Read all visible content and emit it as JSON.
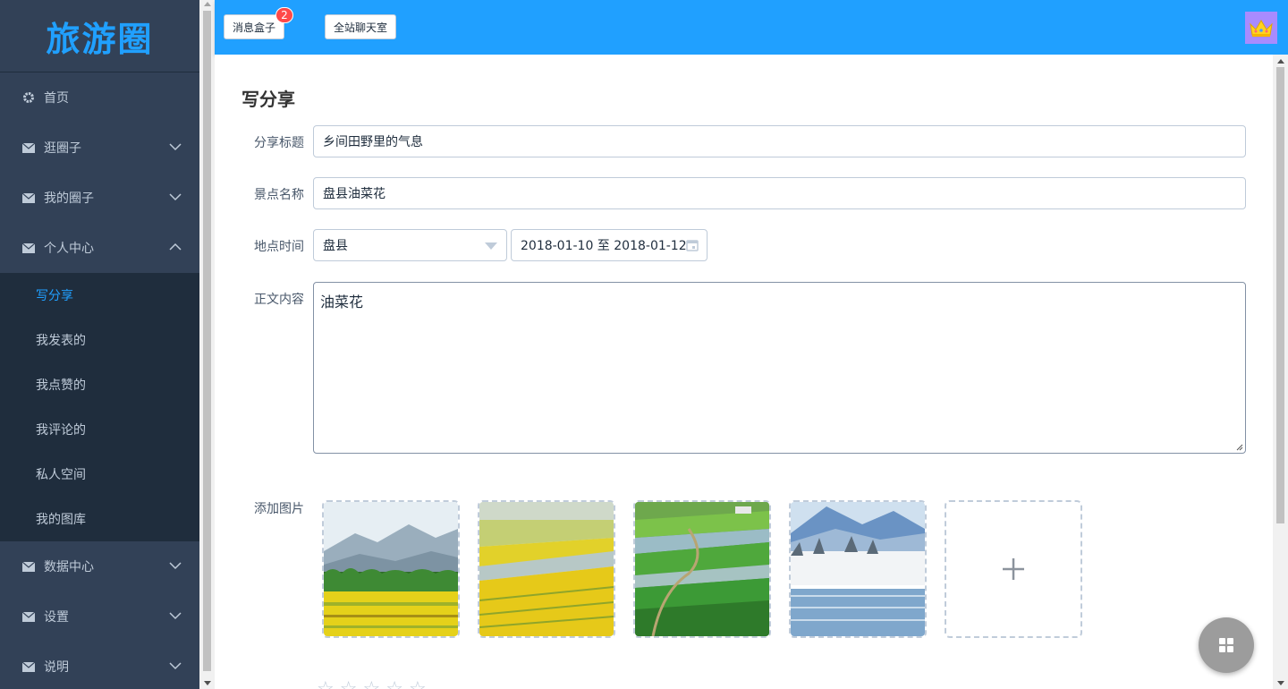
{
  "app": {
    "logo": "旅游圈"
  },
  "sidebar": {
    "items": [
      {
        "label": "首页",
        "icon": "gear-icon"
      },
      {
        "label": "逛圈子",
        "icon": "mail-icon"
      },
      {
        "label": "我的圈子",
        "icon": "mail-icon"
      },
      {
        "label": "个人中心",
        "icon": "mail-icon",
        "expanded": true
      },
      {
        "label": "数据中心",
        "icon": "mail-icon"
      },
      {
        "label": "设置",
        "icon": "mail-icon"
      },
      {
        "label": "说明",
        "icon": "mail-icon"
      }
    ],
    "submenu": [
      "写分享",
      "我发表的",
      "我点赞的",
      "我评论的",
      "私人空间",
      "我的图库"
    ],
    "active_sub": "写分享"
  },
  "header": {
    "message_box_label": "消息盒子",
    "message_count": "2",
    "chatroom_label": "全站聊天室",
    "avatar_icon": "crown-icon",
    "bg_color": "#20a0ff"
  },
  "form": {
    "page_title": "写分享",
    "title_label": "分享标题",
    "title_value": "乡间田野里的气息",
    "spot_label": "景点名称",
    "spot_value": "盘县油菜花",
    "place_time_label": "地点时间",
    "place_value": "盘县",
    "date_range_value": "2018-01-10 至 2018-01-12",
    "content_label": "正文内容",
    "content_value": "油菜花",
    "images_label": "添加图片",
    "images": [
      "field-mountains-photo",
      "rapeseed-field-photo",
      "green-terraces-photo",
      "snow-lake-photo"
    ],
    "add_image_icon": "plus-icon",
    "rating_stars": 5
  },
  "colors": {
    "sidebar_bg": "#324157",
    "submenu_bg": "#1f2d3d",
    "accent": "#20a0ff",
    "badge": "#ff4949"
  }
}
